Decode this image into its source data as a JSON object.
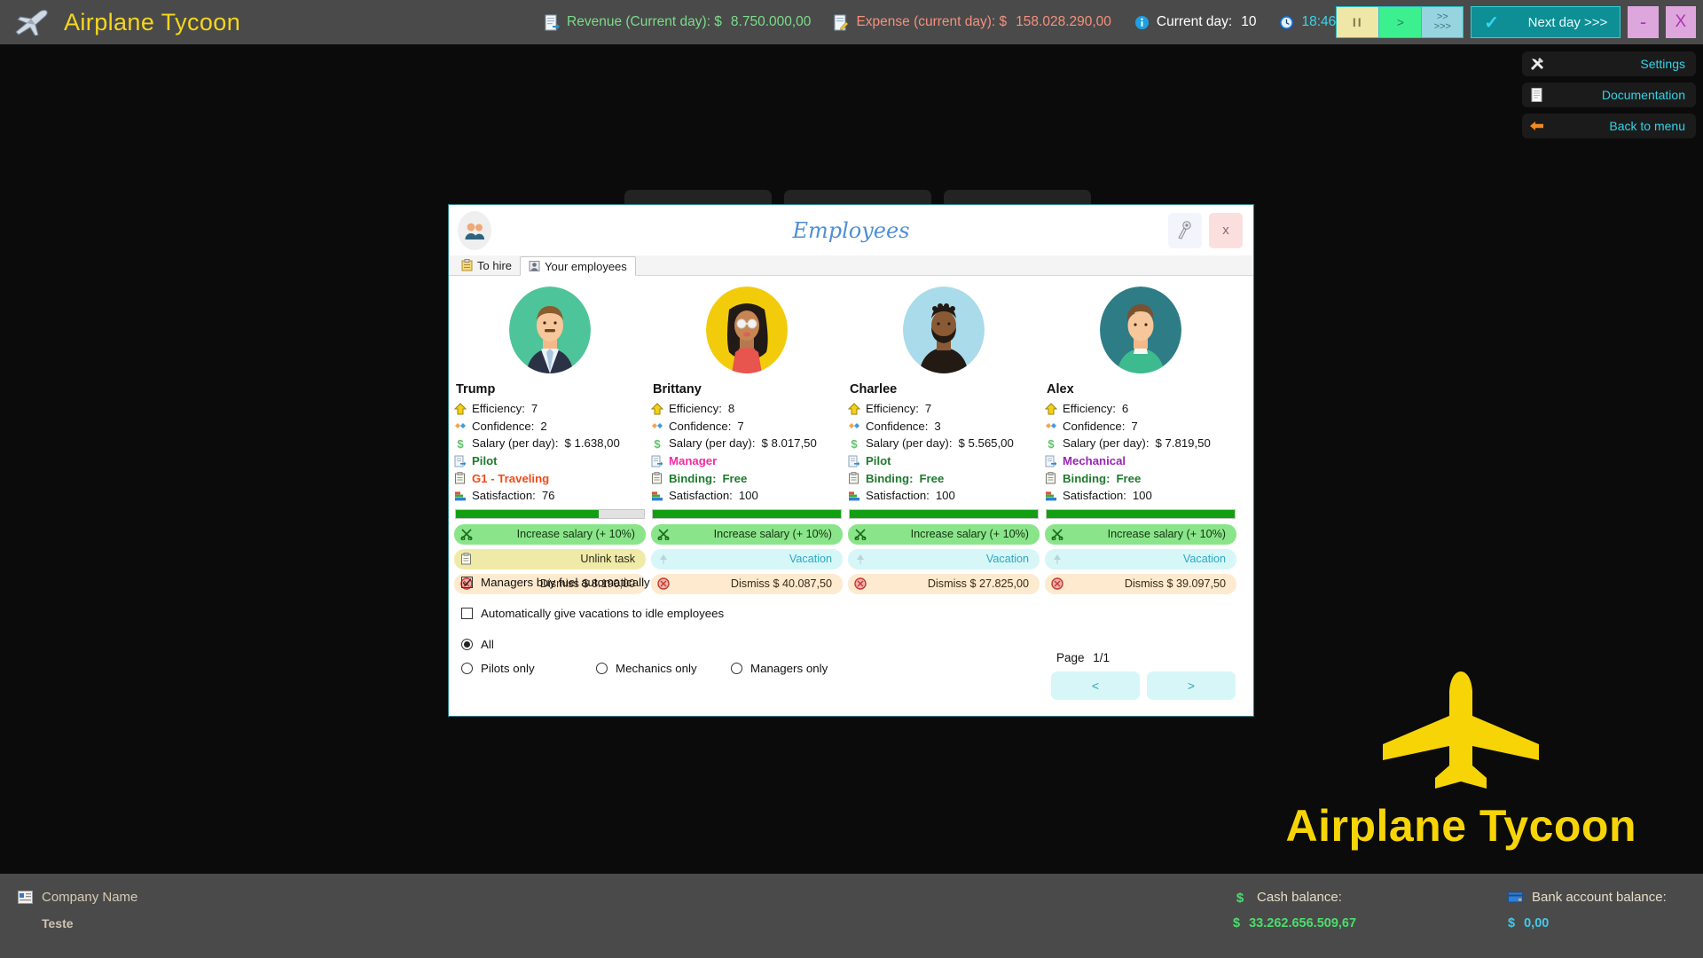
{
  "app": {
    "title": "Airplane Tycoon",
    "logo_icon": "airplane-icon"
  },
  "topbar": {
    "revenue": {
      "icon": "document-revenue-icon",
      "label": "Revenue (Current day): $",
      "value": "8.750.000,00"
    },
    "expense": {
      "icon": "document-expense-icon",
      "label": "Expense (current day): $",
      "value": "158.028.290,00"
    },
    "current_day": {
      "icon": "info-icon",
      "label": "Current day:",
      "value": "10"
    },
    "clock": {
      "icon": "clock-icon",
      "value": "18:46"
    },
    "speed": {
      "pause": "II",
      "play": ">",
      "fast": ">>",
      "faster": ">>>"
    },
    "next_day": {
      "label": "Next day >>>",
      "check": "✓"
    },
    "minimize": "-",
    "close": "X"
  },
  "right_menu": {
    "items": [
      {
        "icon": "tools-icon",
        "label": "Settings"
      },
      {
        "icon": "document-icon",
        "label": "Documentation"
      },
      {
        "icon": "back-arrow-icon",
        "label": "Back to menu"
      }
    ]
  },
  "dialog": {
    "icon": "employees-icon",
    "title": "Employees",
    "pin_icon": "pin-icon",
    "close_label": "x",
    "tabs": [
      {
        "icon": "clipboard-icon",
        "label": "To hire",
        "active": false
      },
      {
        "icon": "people-icon",
        "label": "Your employees",
        "active": true
      }
    ],
    "labels": {
      "efficiency": "Efficiency:",
      "confidence": "Confidence:",
      "salary": "Salary (per day):",
      "binding": "Binding:",
      "satisfaction": "Satisfaction:"
    },
    "employees": [
      {
        "name": "Trump",
        "avatar": "avatar-man-suit",
        "efficiency": "7",
        "confidence": "2",
        "salary": "$ 1.638,00",
        "role": "Pilot",
        "role_kind": "pilot",
        "task_label": "G1 - Traveling",
        "has_task": true,
        "binding": "",
        "satisfaction": "76",
        "satisfaction_pct": 76,
        "actions": {
          "salary": "Increase salary (+ 10%)",
          "secondary": "Unlink task",
          "secondary_kind": "unlink",
          "dismiss": "Dismiss $ 8.190,00"
        }
      },
      {
        "name": "Brittany",
        "avatar": "avatar-woman-sunglasses",
        "efficiency": "8",
        "confidence": "7",
        "salary": "$ 8.017,50",
        "role": "Manager",
        "role_kind": "manager",
        "task_label": "",
        "has_task": false,
        "binding": "Free",
        "satisfaction": "100",
        "satisfaction_pct": 100,
        "actions": {
          "salary": "Increase salary (+ 10%)",
          "secondary": "Vacation",
          "secondary_kind": "vacation",
          "dismiss": "Dismiss $ 40.087,50"
        }
      },
      {
        "name": "Charlee",
        "avatar": "avatar-man-beard",
        "efficiency": "7",
        "confidence": "3",
        "salary": "$ 5.565,00",
        "role": "Pilot",
        "role_kind": "pilot",
        "task_label": "",
        "has_task": false,
        "binding": "Free",
        "satisfaction": "100",
        "satisfaction_pct": 100,
        "actions": {
          "salary": "Increase salary (+ 10%)",
          "secondary": "Vacation",
          "secondary_kind": "vacation",
          "dismiss": "Dismiss $ 27.825,00"
        }
      },
      {
        "name": "Alex",
        "avatar": "avatar-man-green",
        "efficiency": "6",
        "confidence": "7",
        "salary": "$ 7.819,50",
        "role": "Mechanical",
        "role_kind": "mechanical",
        "task_label": "",
        "has_task": false,
        "binding": "Free",
        "satisfaction": "100",
        "satisfaction_pct": 100,
        "actions": {
          "salary": "Increase salary (+ 10%)",
          "secondary": "Vacation",
          "secondary_kind": "vacation",
          "dismiss": "Dismiss $ 39.097,50"
        }
      }
    ],
    "options": {
      "managers_buy_fuel": {
        "label": "Managers buy fuel automatically",
        "checked": true
      },
      "auto_vacations": {
        "label": "Automatically give vacations to idle employees",
        "checked": false
      },
      "filters": [
        {
          "label": "All",
          "selected": true
        },
        {
          "label": "Pilots only",
          "selected": false
        },
        {
          "label": "Mechanics only",
          "selected": false
        },
        {
          "label": "Managers only",
          "selected": false
        }
      ]
    },
    "pager": {
      "label": "Page",
      "value": "1/1",
      "prev": "<",
      "next": ">"
    }
  },
  "watermark": {
    "text": "Airplane Tycoon",
    "icon": "airplane-big-icon"
  },
  "bottombar": {
    "company": {
      "icon": "card-icon",
      "label": "Company Name",
      "value": "Teste"
    },
    "cash": {
      "icon": "dollar-icon",
      "label": "Cash balance:",
      "currency": "$",
      "value": "33.262.656.509,67"
    },
    "bank": {
      "icon": "bank-card-icon",
      "label": "Bank account balance:",
      "currency": "$",
      "value": "0,00"
    }
  }
}
